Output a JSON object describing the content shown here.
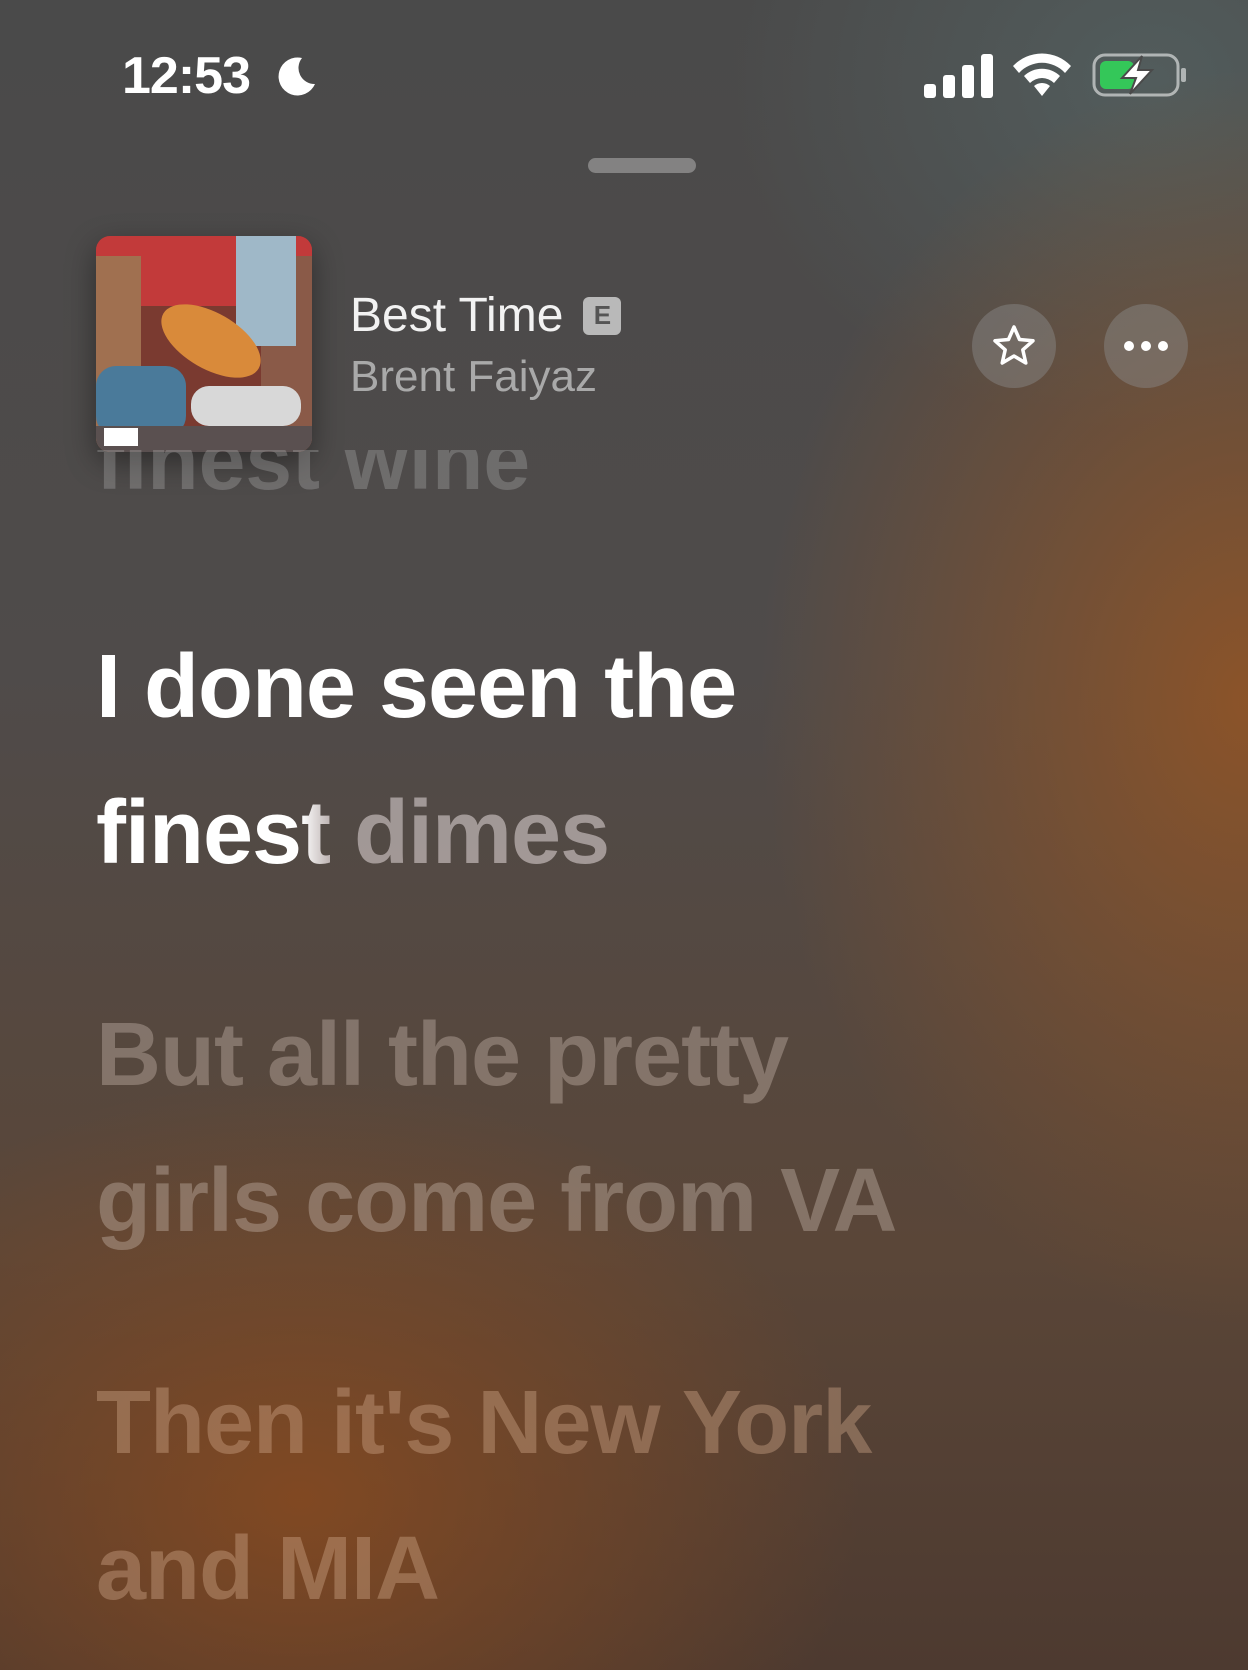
{
  "status_bar": {
    "time": "12:53",
    "icons": [
      "moon-icon",
      "cellular-signal-icon",
      "wifi-icon",
      "battery-charging-icon"
    ],
    "battery_color": "#34c759"
  },
  "now_playing": {
    "title": "Best Time",
    "explicit_badge": "E",
    "artist": "Brent Faiyaz",
    "buttons": [
      "star-icon",
      "more-icon"
    ]
  },
  "lyrics": {
    "previous_line": "finest wine",
    "current_line": {
      "line1": "I done seen the",
      "line2_sung": "fines",
      "line2_partial": "t",
      "line2_unsung": " dimes"
    },
    "upcoming_lines": [
      {
        "line1": "But all the pretty",
        "line2": "girls come from VA"
      },
      {
        "line1": "Then it's New York",
        "line2": "and MIA"
      }
    ]
  }
}
